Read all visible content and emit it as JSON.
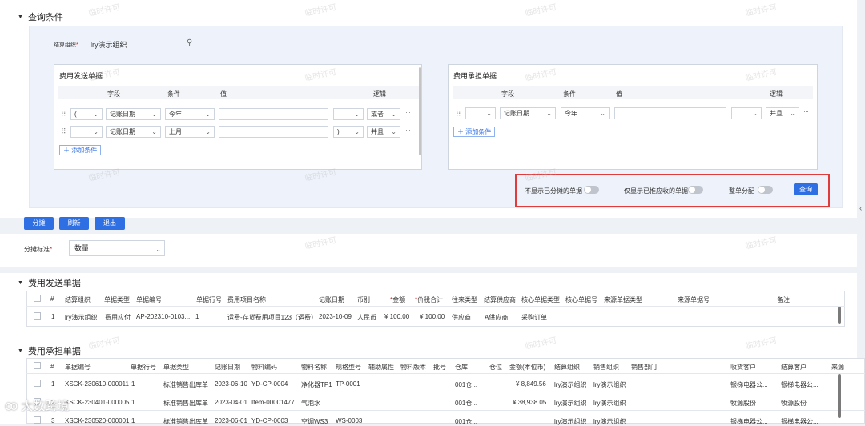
{
  "query": {
    "title": "查询条件",
    "org_label": "结算组织",
    "org_value": "lry演示组织"
  },
  "left_box": {
    "title": "费用发送单据",
    "headers": [
      "字段",
      "条件",
      "值",
      "逻辑"
    ],
    "rows": [
      {
        "paren_open": "(",
        "field": "记账日期",
        "cond": "今年",
        "paren_close": "",
        "logic": "或者"
      },
      {
        "paren_open": "",
        "field": "记账日期",
        "cond": "上月",
        "paren_close": ")",
        "logic": "并且"
      }
    ],
    "add": "添加条件"
  },
  "right_box": {
    "title": "费用承担单据",
    "headers": [
      "字段",
      "条件",
      "值",
      "逻辑"
    ],
    "rows": [
      {
        "field": "记账日期",
        "cond": "今年",
        "logic": "并且"
      }
    ],
    "add": "添加条件"
  },
  "options": {
    "opt1": "不显示已分摊的单据",
    "opt2": "仅显示已推应收的单据",
    "opt3": "整单分配",
    "query_btn": "查询"
  },
  "actions": {
    "allocate": "分摊",
    "refresh": "刷新",
    "exit": "退出"
  },
  "alloc": {
    "label": "分摊标准",
    "value": "数量"
  },
  "send_table": {
    "title": "费用发送单据",
    "headers": [
      "#",
      "结算组织",
      "单据类型",
      "单据编号",
      "单据行号",
      "费用项目名称",
      "记账日期",
      "币别",
      "金额",
      "价税合计",
      "往来类型",
      "结算供应商",
      "核心单据类型",
      "核心单据号",
      "来源单据类型",
      "来源单据号",
      "备注"
    ],
    "rows": [
      {
        "no": "1",
        "org": "lry演示组织",
        "type": "费用应付",
        "bill": "AP-202310-0103...",
        "line": "1",
        "item": "运费-存货费用项目123（运费）",
        "date": "2023-10-09",
        "cur": "人民币",
        "amt": "¥ 100.00",
        "tax": "¥ 100.00",
        "party": "供应商",
        "supplier": "A供应商",
        "core_type": "采购订单"
      }
    ]
  },
  "bear_table": {
    "title": "费用承担单据",
    "headers": [
      "#",
      "单据编号",
      "单据行号",
      "单据类型",
      "记账日期",
      "物料编码",
      "物料名称",
      "规格型号",
      "辅助属性",
      "物料版本",
      "批号",
      "仓库",
      "仓位",
      "金额(本位币)",
      "结算组织",
      "销售组织",
      "销售部门",
      "收货客户",
      "结算客户",
      "来源"
    ],
    "rows": [
      {
        "no": "1",
        "bill": "XSCK-230610-000011",
        "line": "1",
        "type": "标准销售出库单",
        "date": "2023-06-10",
        "code": "YD-CP-0004",
        "name": "净化器TP1",
        "spec": "TP-0001",
        "wh": "001仓...",
        "amt": "¥ 8,849.56",
        "org": "lry演示组织",
        "sorg": "lry演示组织",
        "cust": "银梯电器公...",
        "scust": "银梯电器公..."
      },
      {
        "no": "2",
        "bill": "XSCK-230401-000005",
        "line": "1",
        "type": "标准销售出库单",
        "date": "2023-04-01",
        "code": "Item-00001477",
        "name": "气泡水",
        "spec": "",
        "wh": "001仓...",
        "amt": "¥ 38,938.05",
        "org": "lry演示组织",
        "sorg": "lry演示组织",
        "cust": "牧源股份",
        "scust": "牧源股份"
      },
      {
        "no": "3",
        "bill": "XSCK-230520-000001",
        "line": "1",
        "type": "标准销售出库单",
        "date": "2023-06-01",
        "code": "YD-CP-0003",
        "name": "空调WS3",
        "spec": "WS-0003",
        "wh": "001仓...",
        "amt": "",
        "org": "lry演示组织",
        "sorg": "lry演示组织",
        "cust": "银梯电器公...",
        "scust": "银梯电器公..."
      }
    ]
  },
  "watermark": "临时许可",
  "brand": "大数跨境"
}
